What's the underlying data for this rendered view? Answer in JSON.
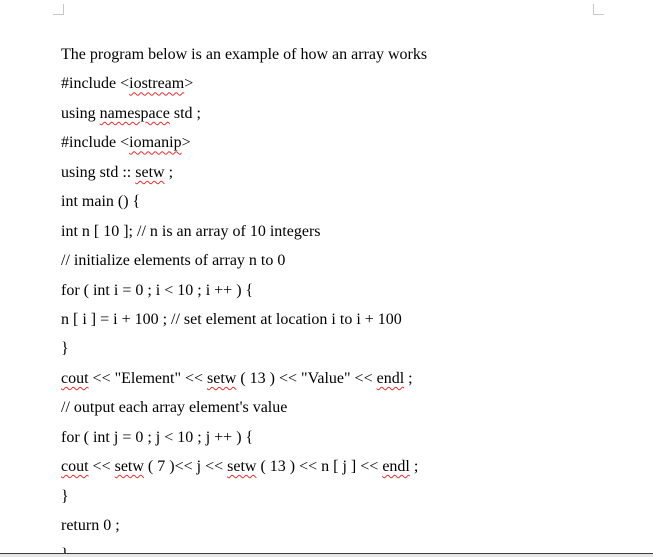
{
  "lines": [
    {
      "segments": [
        {
          "text": "The program below is an example of how an array works"
        }
      ]
    },
    {
      "segments": [
        {
          "text": "#include <"
        },
        {
          "text": "iostream",
          "spell": true
        },
        {
          "text": ">"
        }
      ]
    },
    {
      "segments": [
        {
          "text": "using "
        },
        {
          "text": "namespace",
          "spell": true
        },
        {
          "text": " std ;"
        }
      ]
    },
    {
      "segments": [
        {
          "text": "#include <"
        },
        {
          "text": "iomanip",
          "spell": true
        },
        {
          "text": ">"
        }
      ]
    },
    {
      "segments": [
        {
          "text": "using std :: "
        },
        {
          "text": "setw",
          "spell": true
        },
        {
          "text": " ;"
        }
      ]
    },
    {
      "segments": [
        {
          "text": "int main () {"
        }
      ]
    },
    {
      "segments": [
        {
          "text": "int n [ 10 ]; // n is an array of 10 integers"
        }
      ]
    },
    {
      "segments": [
        {
          "text": "// initialize elements of array n to 0"
        }
      ]
    },
    {
      "segments": [
        {
          "text": "for ( int i = 0 ; i < 10 ; i ++ ) {"
        }
      ]
    },
    {
      "segments": [
        {
          "text": "n [ i ] = i + 100 ; // set element at location i to i + 100"
        }
      ]
    },
    {
      "segments": [
        {
          "text": "}"
        }
      ]
    },
    {
      "segments": [
        {
          "text": "cout",
          "spell": true
        },
        {
          "text": " << \"Element\" << "
        },
        {
          "text": "setw",
          "spell": true
        },
        {
          "text": " ( 13 ) << \"Value\" << "
        },
        {
          "text": "endl",
          "spell": true
        },
        {
          "text": " ;"
        }
      ]
    },
    {
      "segments": [
        {
          "text": "// output each array element's value"
        }
      ]
    },
    {
      "segments": [
        {
          "text": "for ( int j = 0 ; j < 10 ; j ++ ) {"
        }
      ]
    },
    {
      "segments": [
        {
          "text": "cout",
          "spell": true
        },
        {
          "text": " << "
        },
        {
          "text": "setw",
          "spell": true
        },
        {
          "text": " ( 7 )<< j << "
        },
        {
          "text": "setw",
          "spell": true
        },
        {
          "text": " ( 13 ) << n [ j ] << "
        },
        {
          "text": "endl",
          "spell": true
        },
        {
          "text": " ;"
        }
      ]
    },
    {
      "segments": [
        {
          "text": "}"
        }
      ]
    },
    {
      "segments": [
        {
          "text": "return 0 ;"
        }
      ]
    },
    {
      "segments": [
        {
          "text": "}"
        }
      ]
    }
  ]
}
